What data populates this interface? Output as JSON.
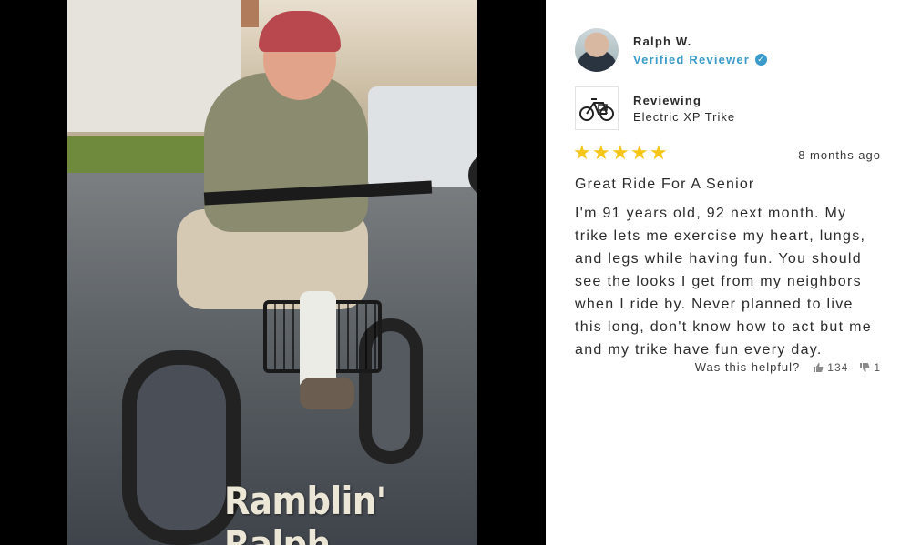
{
  "media": {
    "caption": "Ramblin' Ralph"
  },
  "reviewer": {
    "name": "Ralph W.",
    "status": "Verified Reviewer",
    "badge_icon": "check-circle-icon"
  },
  "product": {
    "reviewing_label": "Reviewing",
    "name": "Electric XP Trike"
  },
  "review": {
    "rating": 5,
    "rating_max": 5,
    "date": "8 months ago",
    "title": "Great Ride For A Senior",
    "body": "I'm 91 years old, 92 next month. My trike lets me exercise my heart, lungs, and legs while having fun. You should see the looks I get from my neighbors when I ride by. Never planned to live this long, don't know how to act but me and my trike have fun every day."
  },
  "helpful": {
    "label": "Was this helpful?",
    "up_count": "134",
    "down_count": "1"
  },
  "colors": {
    "accent": "#3a9ac9",
    "star": "#f5c518"
  }
}
